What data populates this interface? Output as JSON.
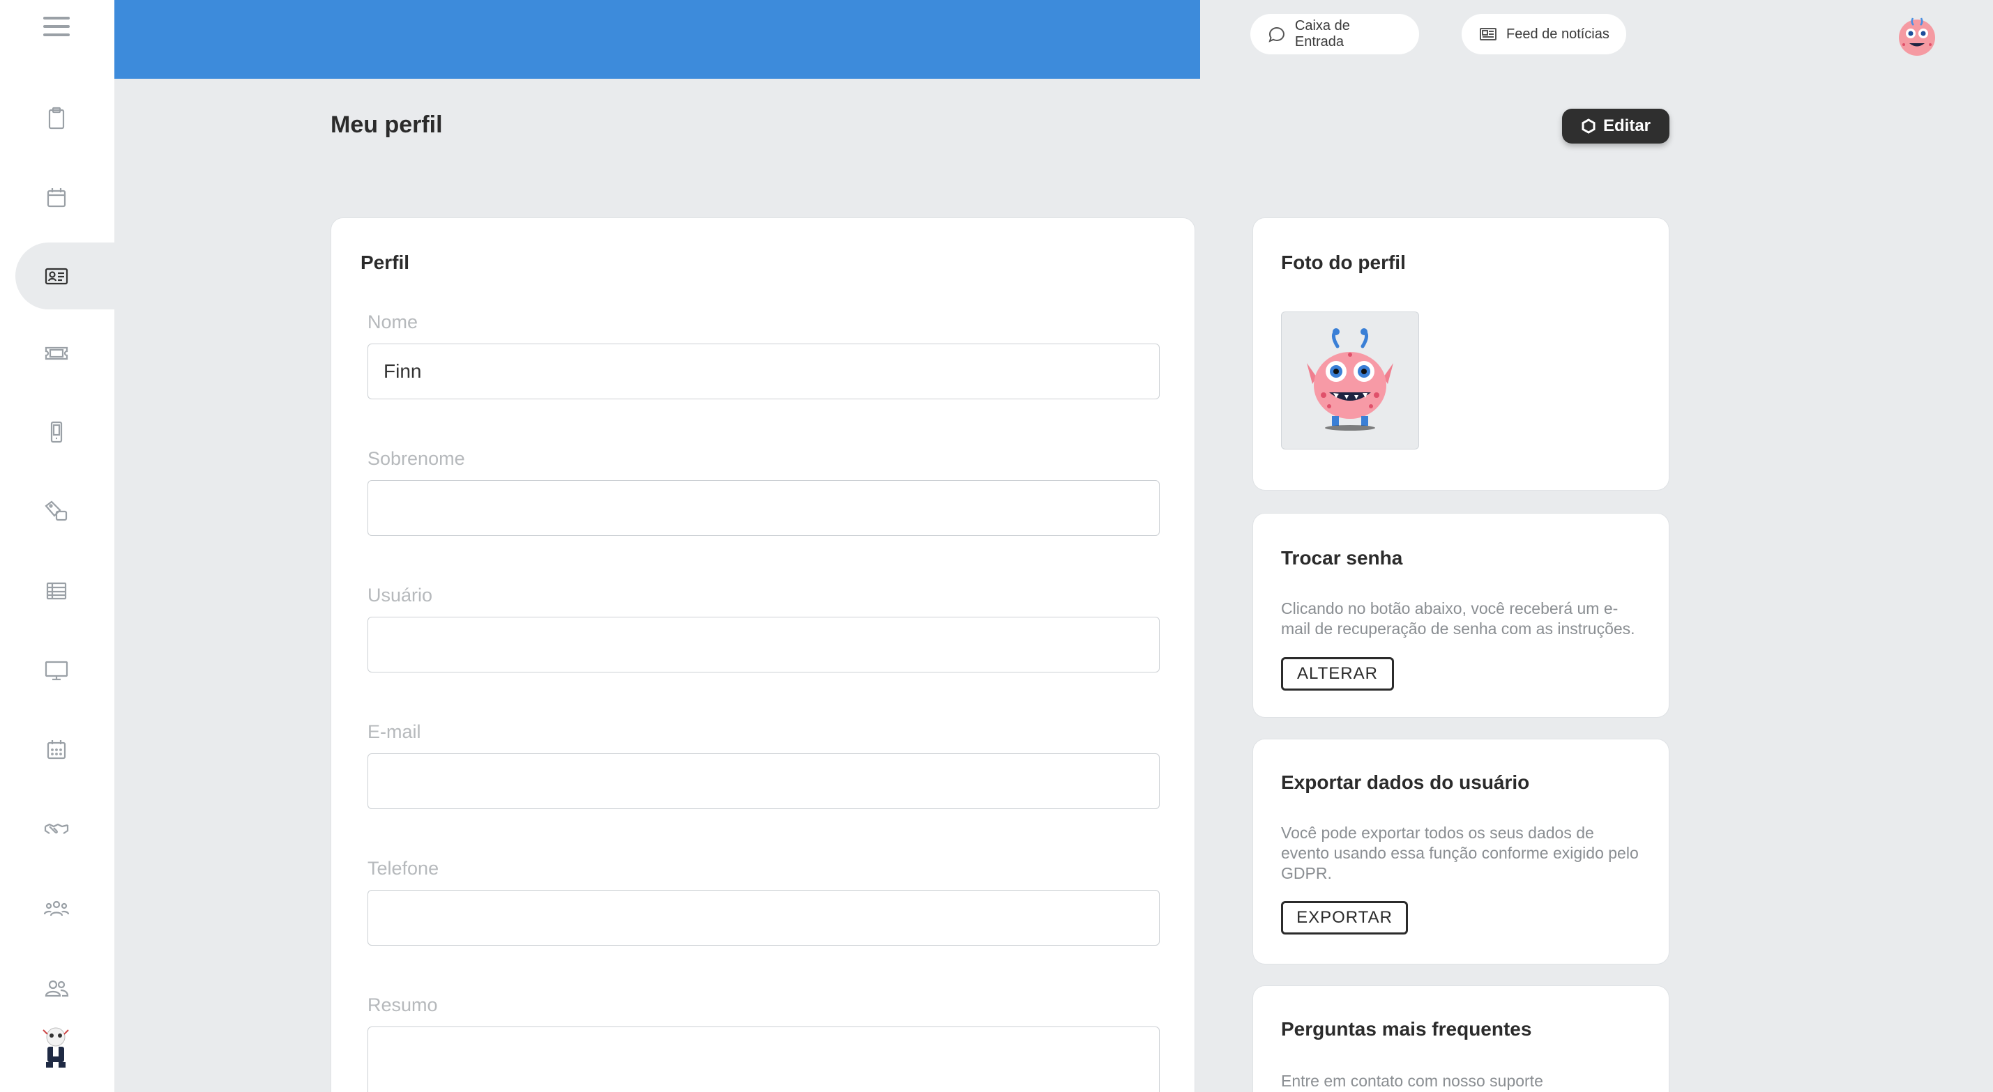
{
  "sidebar": {
    "items": [
      {
        "name": "clipboard"
      },
      {
        "name": "calendar"
      },
      {
        "name": "id-card",
        "active": true
      },
      {
        "name": "ticket"
      },
      {
        "name": "mobile"
      },
      {
        "name": "tags"
      },
      {
        "name": "table"
      },
      {
        "name": "monitor"
      },
      {
        "name": "calendar-grid"
      },
      {
        "name": "handshake"
      },
      {
        "name": "group"
      },
      {
        "name": "users"
      }
    ]
  },
  "topbar": {
    "inbox_label": "Caixa de Entrada",
    "news_label": "Feed de notícias"
  },
  "page": {
    "title": "Meu perfil",
    "edit_label": "Editar"
  },
  "profile": {
    "title": "Perfil",
    "fields": [
      {
        "label": "Nome",
        "value": "Finn"
      },
      {
        "label": "Sobrenome",
        "value": ""
      },
      {
        "label": "Usuário",
        "value": ""
      },
      {
        "label": "E-mail",
        "value": ""
      },
      {
        "label": "Telefone",
        "value": ""
      },
      {
        "label": "Resumo",
        "value": ""
      }
    ]
  },
  "photo": {
    "title": "Foto do perfil"
  },
  "password": {
    "title": "Trocar senha",
    "text": "Clicando no botão abaixo, você receberá um e-mail de recuperação de senha com as instruções.",
    "button": "ALTERAR"
  },
  "export": {
    "title": "Exportar dados do usuário",
    "text": "Você pode exportar todos os seus dados de evento usando essa função conforme exigido pelo GDPR.",
    "button": "EXPORTAR"
  },
  "faq": {
    "title": "Perguntas mais frequentes",
    "text": "Entre em contato com nosso suporte"
  },
  "colors": {
    "accent_blue": "#3d8bdb",
    "background": "#e9ebed",
    "dark_button": "#2f2f2f"
  }
}
